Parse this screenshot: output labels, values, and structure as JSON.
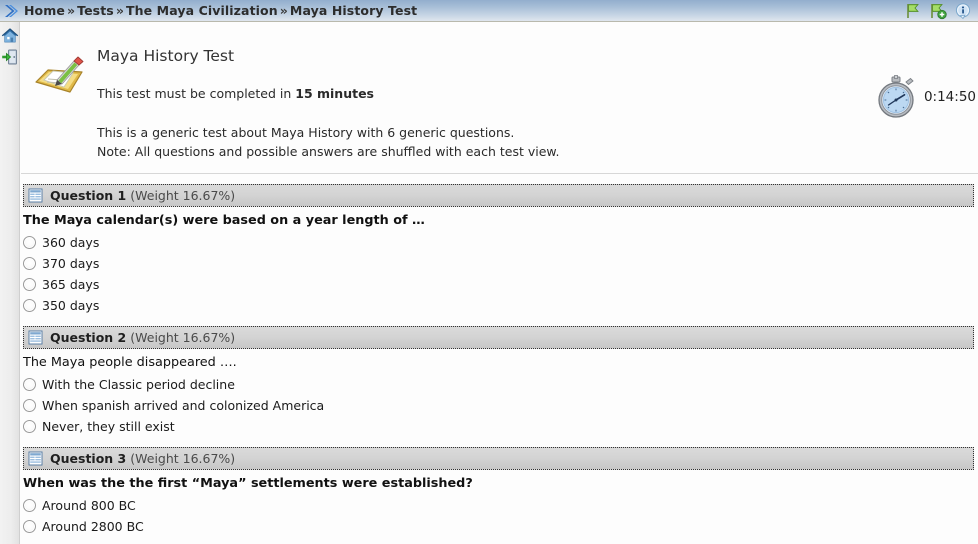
{
  "breadcrumb": {
    "arrow_icon": "blue-chevron-right-icon",
    "items": [
      "Home",
      "Tests",
      "The Maya Civilization",
      "Maya History Test"
    ],
    "separator": "»"
  },
  "topbar_icons": [
    {
      "name": "flag-icon",
      "title": "Flag"
    },
    {
      "name": "flag-add-icon",
      "title": "Add flag"
    },
    {
      "name": "info-icon",
      "title": "Information"
    }
  ],
  "left_rail": [
    {
      "name": "home-icon",
      "title": "Home"
    },
    {
      "name": "logout-icon",
      "title": "Log out"
    }
  ],
  "test": {
    "icon": "pencil-writing-icon",
    "title": "Maya History Test",
    "time_notice_prefix": "This test must be completed in ",
    "time_notice_value": "15 minutes",
    "description_line1": "This is a generic test about Maya History with 6 generic questions.",
    "description_line2": "Note: All questions and possible answers are shuffled with each test view.",
    "timer_icon": "stopwatch-icon",
    "timer_value": "0:14:50"
  },
  "questions": [
    {
      "icon": "question-form-icon",
      "label": "Question 1",
      "weight": "(Weight 16.67%)",
      "prompt": "The Maya calendar(s) were based on a year length of …",
      "prompt_bold": true,
      "options": [
        "360 days",
        "370 days",
        "365 days",
        "350 days"
      ]
    },
    {
      "icon": "question-form-icon",
      "label": "Question 2",
      "weight": "(Weight 16.67%)",
      "prompt": "The Maya people disappeared ….",
      "prompt_bold": false,
      "options": [
        "With  the  Classic  period  decline",
        "When  spanish  arrived  and  colonized  America",
        "Never,  they  still  exist"
      ]
    },
    {
      "icon": "question-form-icon",
      "label": "Question 3",
      "weight": "(Weight 16.67%)",
      "prompt": "When was the the first “Maya” settlements were established?",
      "prompt_bold": true,
      "options": [
        "Around 800 BC",
        "Around 2800 BC"
      ]
    }
  ],
  "colors": {
    "topbar_gradient_start": "#93aecd",
    "topbar_gradient_end": "#dfe6ee",
    "question_header_bg": "#d3d3d3",
    "page_bg": "#fdfdfd",
    "text": "#1a1a1a"
  }
}
